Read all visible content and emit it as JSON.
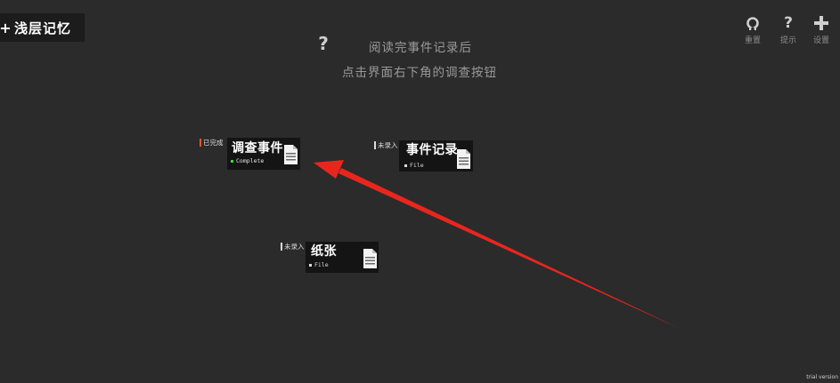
{
  "header": {
    "plus_symbol": "+",
    "title": "浅层记忆"
  },
  "hint": {
    "icon": "question-icon",
    "line1": "阅读完事件记录后",
    "line2": "点击界面右下角的调查按钮"
  },
  "toolbar": [
    {
      "id": "reset",
      "icon": "reset-icon",
      "label": "重置"
    },
    {
      "id": "tips",
      "icon": "question-icon",
      "label": "提示"
    },
    {
      "id": "settings",
      "icon": "plus-icon",
      "label": "设置"
    }
  ],
  "cards": [
    {
      "status": "已完成",
      "name": "调查事件",
      "sub": "Complete",
      "icon": "document-icon"
    },
    {
      "status": "未录入",
      "name": "事件记录",
      "sub": "File",
      "icon": "document-icon"
    },
    {
      "status": "未录入",
      "name": "纸张",
      "sub": "File",
      "icon": "document-icon"
    }
  ],
  "colors": {
    "background": "#2b2b2b",
    "card": "#141414",
    "arrow": "#e8261e",
    "complete_dot": "#3cdc3c",
    "done_bar": "#e0562e"
  },
  "footer": {
    "watermark": "trial version"
  }
}
